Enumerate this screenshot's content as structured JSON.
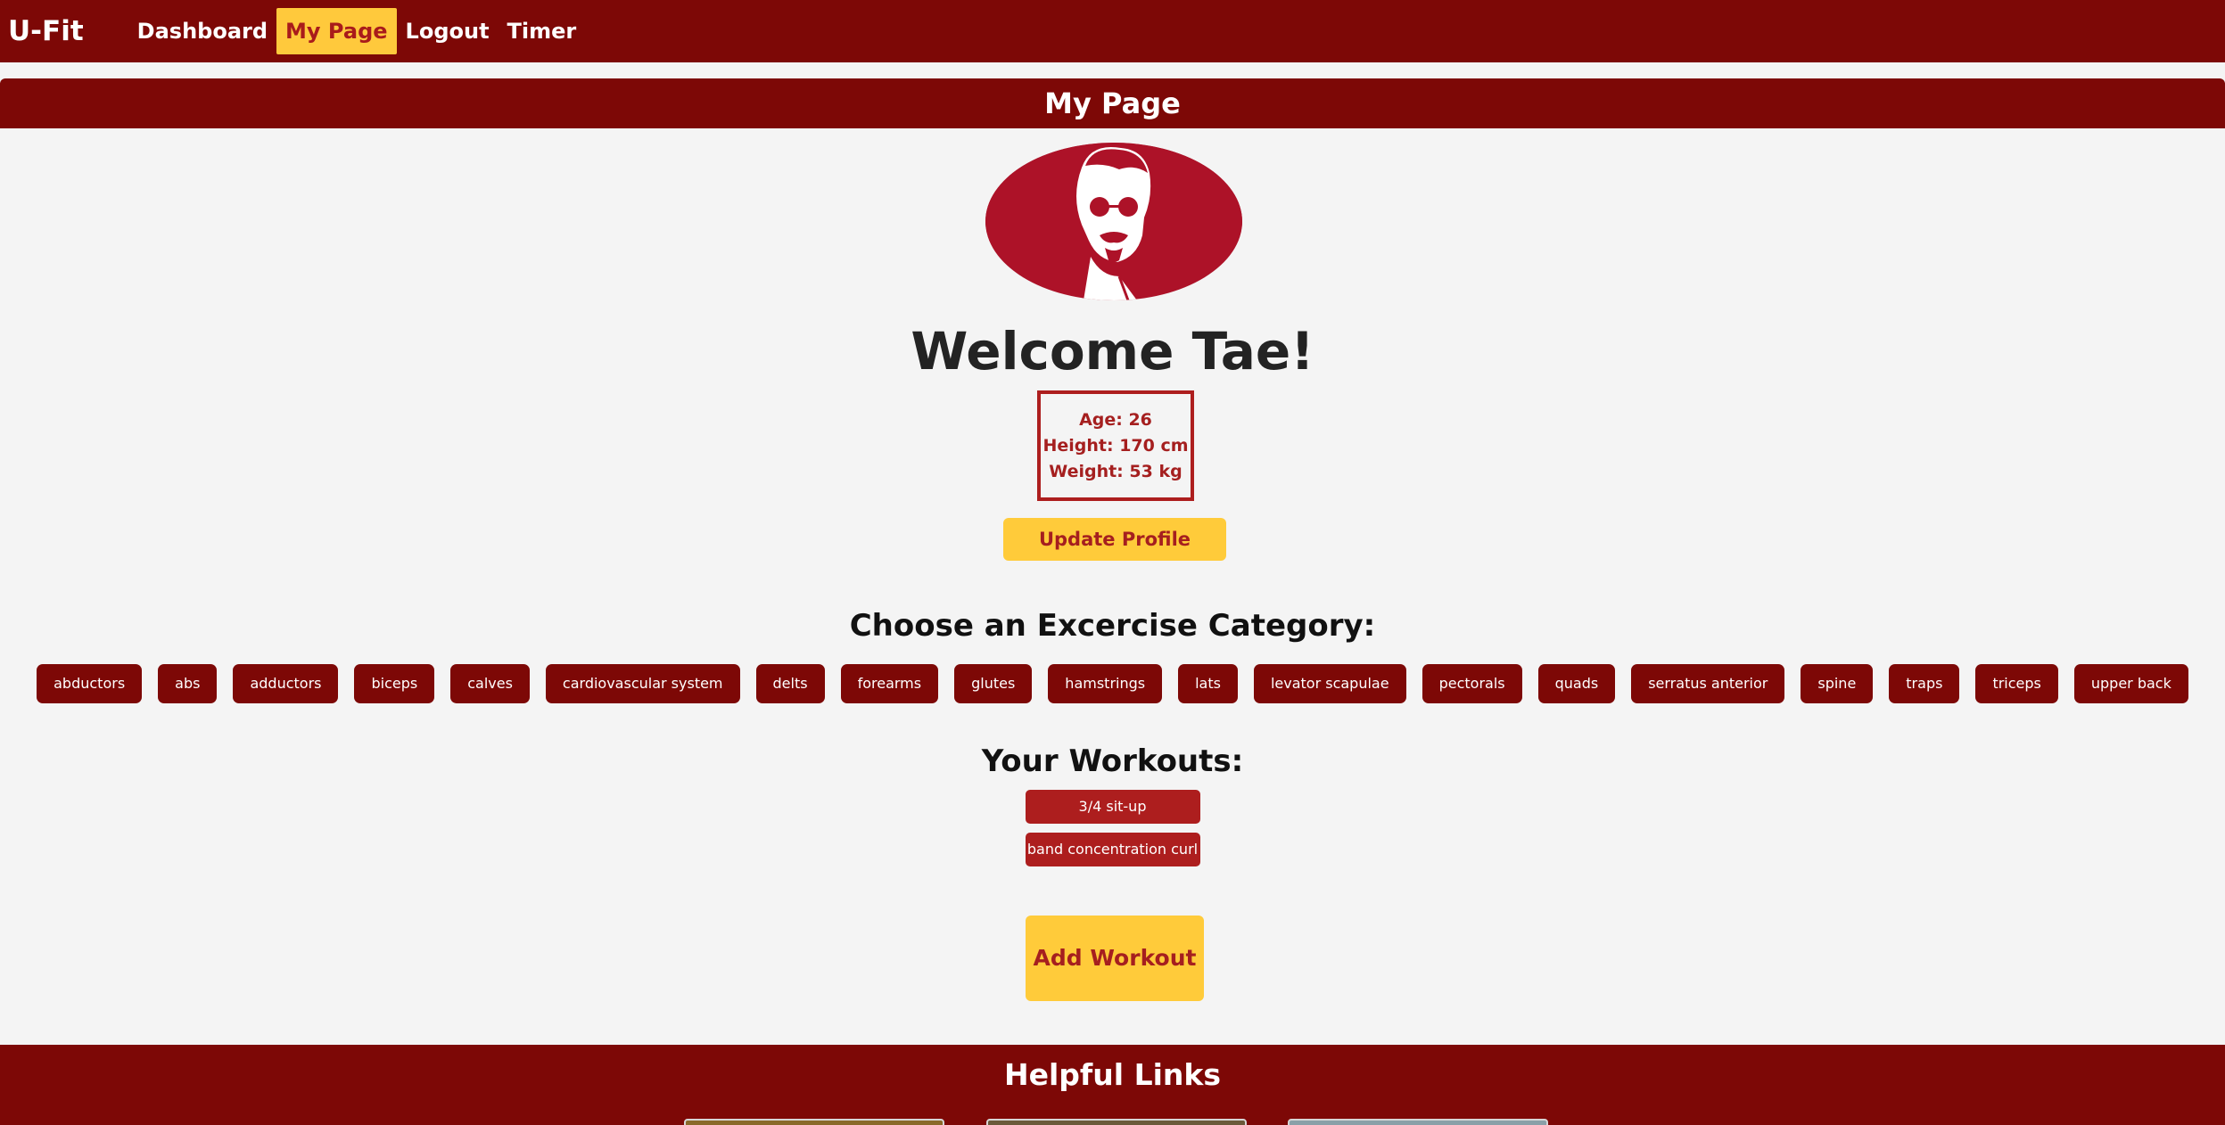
{
  "nav": {
    "brand": "U-Fit",
    "links": [
      "Dashboard",
      "My Page",
      "Logout",
      "Timer"
    ]
  },
  "page": {
    "title": "My Page",
    "welcome": "Welcome Tae!",
    "stats": {
      "age": "Age: 26",
      "height": "Height: 170 cm",
      "weight": "Weight: 53 kg"
    },
    "update_label": "Update Profile"
  },
  "categories": {
    "heading": "Choose an Excercise Category:",
    "items": [
      "abductors",
      "abs",
      "adductors",
      "biceps",
      "calves",
      "cardiovascular system",
      "delts",
      "forearms",
      "glutes",
      "hamstrings",
      "lats",
      "levator scapulae",
      "pectorals",
      "quads",
      "serratus anterior",
      "spine",
      "traps",
      "triceps",
      "upper back"
    ]
  },
  "workouts": {
    "heading": "Your Workouts:",
    "items": [
      "3/4 sit-up",
      "band concentration curl"
    ],
    "add_label": "Add Workout"
  },
  "footer": {
    "title": "Helpful Links"
  },
  "colors": {
    "primary": "#7d0806",
    "accent": "#ffc93c",
    "text_accent": "#a51f1f"
  }
}
